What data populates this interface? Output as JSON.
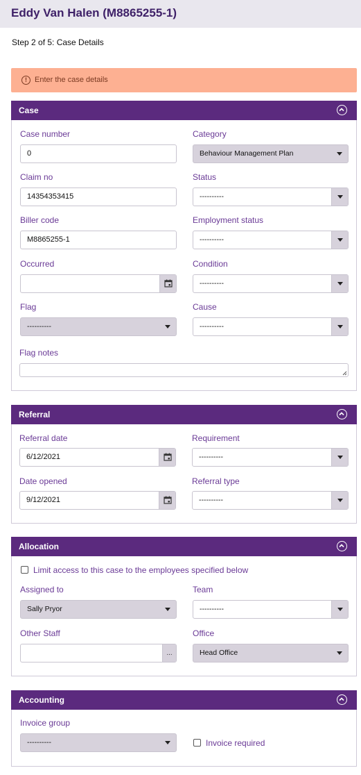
{
  "header": {
    "title": "Eddy Van Halen (M8865255-1)",
    "step": "Step 2 of 5: Case Details"
  },
  "alert": {
    "icon": "info-icon",
    "text": "Enter the case details",
    "color": "#fdb092"
  },
  "theme": {
    "accent": "#5b2a7e",
    "label_color": "#6a3a96"
  },
  "case": {
    "title": "Case",
    "case_number_label": "Case number",
    "case_number_value": "0",
    "category_label": "Category",
    "category_value": "Behaviour Management Plan",
    "claim_no_label": "Claim no",
    "claim_no_value": "14354353415",
    "status_label": "Status",
    "status_value": "----------",
    "biller_code_label": "Biller code",
    "biller_code_value": "M8865255-1",
    "employment_status_label": "Employment status",
    "employment_status_value": "----------",
    "occurred_label": "Occurred",
    "occurred_value": "",
    "condition_label": "Condition",
    "condition_value": "----------",
    "flag_label": "Flag",
    "flag_value": "----------",
    "cause_label": "Cause",
    "cause_value": "----------",
    "flag_notes_label": "Flag notes"
  },
  "referral": {
    "title": "Referral",
    "referral_date_label": "Referral date",
    "referral_date_value": "6/12/2021",
    "requirement_label": "Requirement",
    "requirement_value": "----------",
    "date_opened_label": "Date opened",
    "date_opened_value": "9/12/2021",
    "referral_type_label": "Referral type",
    "referral_type_value": "----------"
  },
  "allocation": {
    "title": "Allocation",
    "limit_access_label": "Limit access to this case to the employees specified below",
    "assigned_to_label": "Assigned to",
    "assigned_to_value": "Sally Pryor",
    "team_label": "Team",
    "team_value": "----------",
    "other_staff_label": "Other Staff",
    "other_staff_value": "",
    "other_staff_button": "...",
    "office_label": "Office",
    "office_value": "Head Office"
  },
  "accounting": {
    "title": "Accounting",
    "invoice_group_label": "Invoice group",
    "invoice_group_value": "----------",
    "invoice_required_label": "Invoice required"
  }
}
